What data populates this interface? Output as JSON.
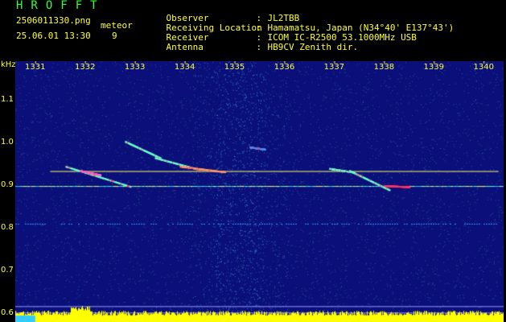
{
  "header": {
    "logo": "HROFFT",
    "file_name": "2506011330.png",
    "datetime": "25.06.01 13:30",
    "meteor_label": "meteor",
    "meteor_count": "9"
  },
  "meta": [
    {
      "key": "Observer",
      "value": "JL2TBB"
    },
    {
      "key": "Receiving Location",
      "value": "Hamamatsu, Japan (N34°40' E137°43')"
    },
    {
      "key": "Receiver",
      "value": "ICOM IC-R2500 53.1000MHz USB"
    },
    {
      "key": "Antenna",
      "value": "HB9CV Zenith dir."
    }
  ],
  "axis": {
    "y_unit": "kHz",
    "y_ticks": [
      "1.1",
      "1.0",
      "0.9",
      "0.8",
      "0.7",
      "0.6"
    ],
    "x_ticks": [
      "1331",
      "1332",
      "1333",
      "1334",
      "1335",
      "1336",
      "1337",
      "1338",
      "1339",
      "1340"
    ]
  },
  "colors": {
    "background": "#000000",
    "text": "#ffff33",
    "logo": "#33ff33",
    "spectrogram_bg": "#0a0f7a",
    "signal_line": "#ffff66",
    "noise_floor": "#ffff00"
  },
  "chart_data": {
    "type": "heatmap",
    "xlabel": "",
    "ylabel": "kHz",
    "x_range": [
      1330.6,
      1340.4
    ],
    "y_range": [
      0.58,
      1.19
    ],
    "carrier_lines_khz": [
      0.933,
      0.898,
      0.81,
      0.617
    ],
    "meteor_count": 9
  }
}
